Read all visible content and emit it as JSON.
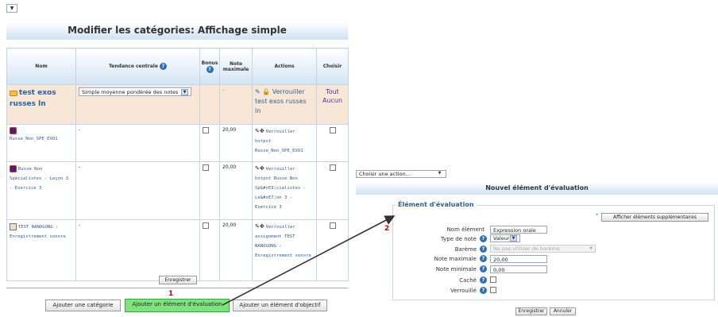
{
  "top_toggle_icon": "chevron-down-icon",
  "left_panel": {
    "title": "Modifier les catégories: Affichage simple",
    "columns": {
      "name": "Nom",
      "central": "Tendance centrale",
      "bonus": "Bonus",
      "max_note": "Note maximale",
      "actions": "Actions",
      "choose": "Choisir"
    },
    "category": {
      "name": "test exos russes ln",
      "aggregation": "Simple moyenne pondérée des notes",
      "max": "-",
      "action": "Verrouiller test exos russes ln",
      "all": "Tout",
      "none": "Aucun"
    },
    "rows": [
      {
        "name": "Russe_Non_SPE_EXO1",
        "central": "-",
        "max": "20,00",
        "action": "Verrouiller hotpot Russe_Non_SPE_EXO1"
      },
      {
        "name": "Russe Non Spécialistes - Leçon 3 - Exercice 3",
        "central": "-",
        "max": "20,00",
        "action": "Verrouiller hotpot Russe Non Sp&#xE9;cialistes - Le&#xE7;on 3 - Exercice 3"
      },
      {
        "name": "TEST NANOGONG : Enregistrement sonore",
        "central": "-",
        "max": "20,00",
        "action": "Verrouiller assignment TEST NANOGONG : Enregistrement sonore"
      }
    ],
    "save_button": "Enregistrer",
    "step1": "1",
    "bottom_buttons": {
      "add_category": "Ajouter une catégorie",
      "add_grade_item": "Ajouter un élément d'évaluation",
      "add_outcome_item": "Ajouter un élément d'objectif"
    }
  },
  "right_panel": {
    "choose_action": "Choisir une action...",
    "title": "Nouvel élément d'évaluation",
    "step2": "2",
    "fieldset_legend": "Élément d'évaluation",
    "show_advanced": "Afficher éléments supplémentaires",
    "fields": {
      "item_name_label": "Nom élément",
      "item_name_value": "Expression orale",
      "grade_type_label": "Type de note",
      "grade_type_value": "Valeur",
      "scale_label": "Barème",
      "scale_value": "Ne pas utiliser de barème",
      "max_label": "Note maximale",
      "max_value": "20,00",
      "min_label": "Note minimale",
      "min_value": "0,00",
      "hidden_label": "Caché",
      "locked_label": "Verrouillé"
    },
    "save": "Enregistrer",
    "cancel": "Annuler"
  },
  "colors": {
    "header_blue": "#cfe1f2",
    "category_row": "#f8e7d7",
    "link": "#345d8c",
    "highlight_green": "#7ee37e",
    "step_red": "#c00000"
  }
}
